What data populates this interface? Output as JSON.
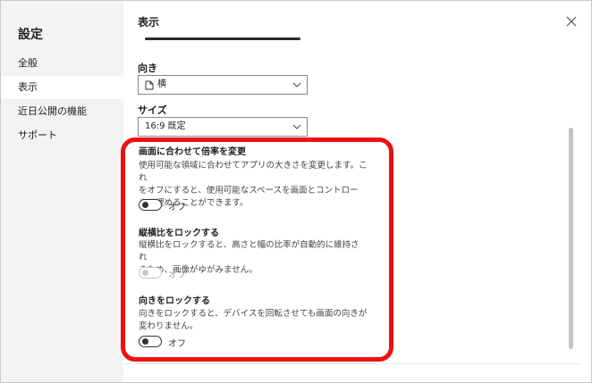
{
  "sidebar": {
    "title": "設定",
    "items": [
      {
        "label": "全般"
      },
      {
        "label": "表示"
      },
      {
        "label": "近日公開の機能"
      },
      {
        "label": "サポート"
      }
    ]
  },
  "main": {
    "title": "表示",
    "orientation": {
      "label": "向き",
      "value": "横",
      "icon": "page-icon"
    },
    "size": {
      "label": "サイズ",
      "value": "16:9 既定"
    }
  },
  "sections": [
    {
      "title": "画面に合わせて倍率を変更",
      "description_lines": [
        "使用可能な領域に合わせてアプリの大きさを変更します。これ",
        "をオフにすると、使用可能なスペースを画面とコントロー",
        "ルで埋めることができます。"
      ],
      "toggle_label": "オフ",
      "enabled": true
    },
    {
      "title": "縦横比をロックする",
      "description_lines": [
        "縦横比をロックすると、高さと幅の比率が自動的に維持され",
        "るため、画像がゆがみません。"
      ],
      "toggle_label": "オフ",
      "enabled": false
    },
    {
      "title": "向きをロックする",
      "description_lines": [
        "向きをロックすると、デバイスを回転させても画面の向きが",
        "変わりません。"
      ],
      "toggle_label": "オフ",
      "enabled": true
    }
  ],
  "colors": {
    "highlight": "#ee1111",
    "sidebar_bg": "#f3f3f3"
  }
}
